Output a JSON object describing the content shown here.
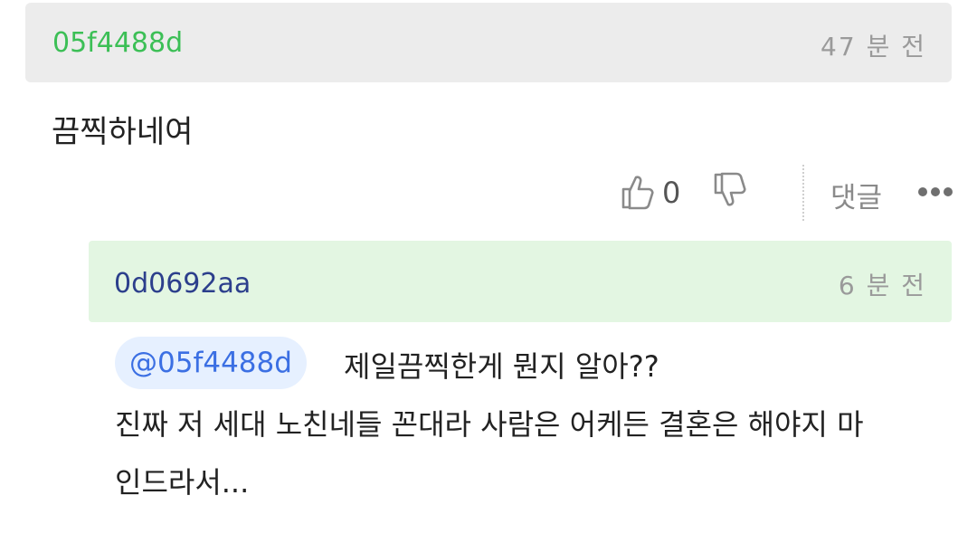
{
  "comment": {
    "author": "05f4488d",
    "time": "47 분 전",
    "body": "끔찍하네여",
    "like_count": "0",
    "reply_label": "댓글",
    "icons": {
      "like": "thumbs-up-icon",
      "dislike": "thumbs-down-icon",
      "more": "more-icon"
    },
    "colors": {
      "author": "#3cbf56",
      "header_bg": "#ececec"
    }
  },
  "reply": {
    "author": "0d0692aa",
    "time": "6 분 전",
    "mention": "@05f4488d",
    "text_first": "제일끔찍한게 뭔지 알아??",
    "text_line2": "진짜 저 세대 노친네들 꼰대라 사람은 어케든 결혼은 해야지 마",
    "text_line3": "인드라서...",
    "colors": {
      "author": "#2c3f8c",
      "header_bg": "#e3f6e2",
      "mention": "#3b6fe3"
    }
  }
}
